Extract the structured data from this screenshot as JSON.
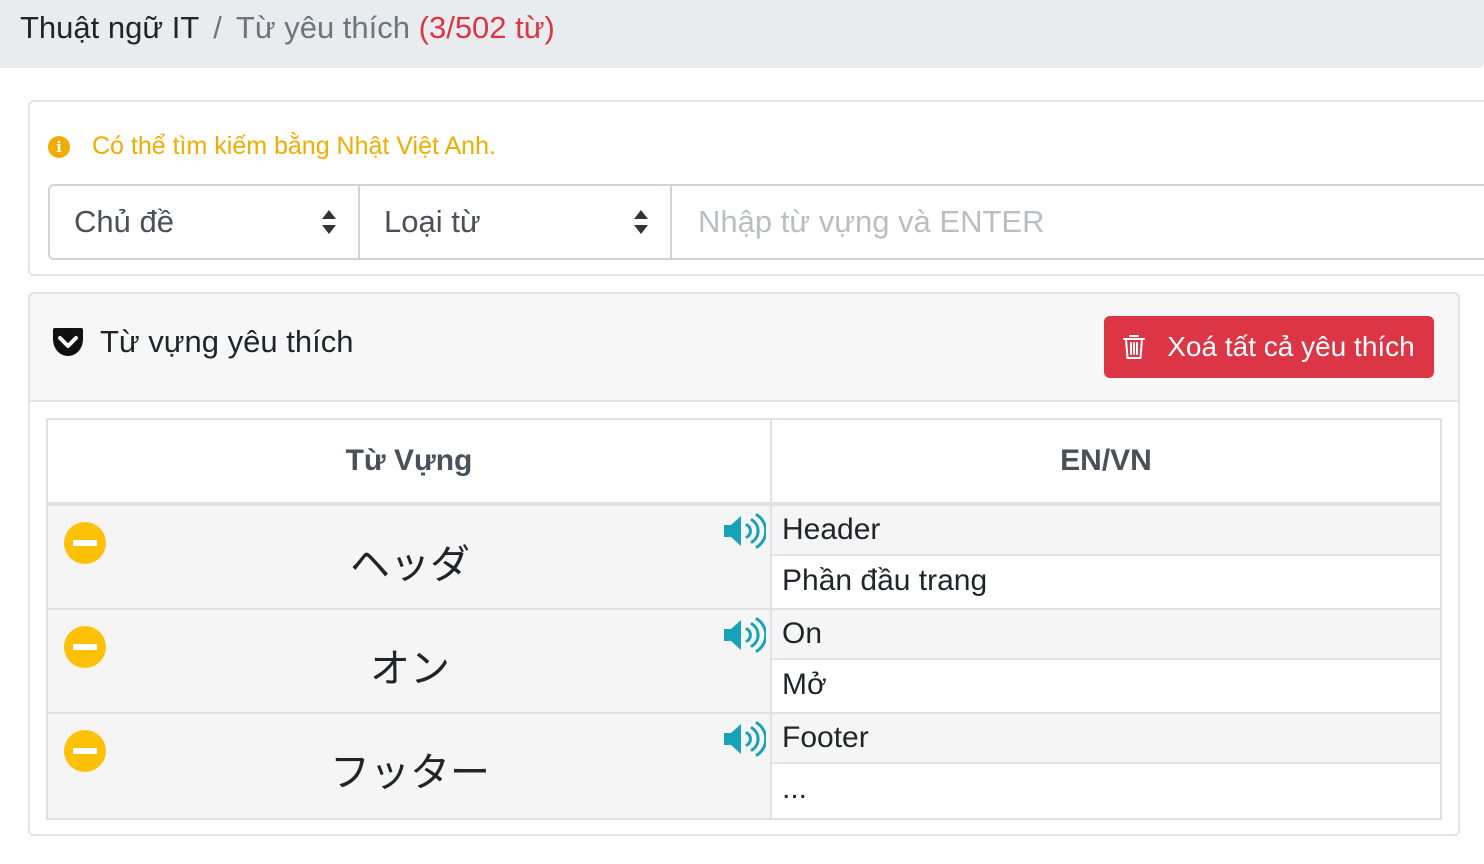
{
  "breadcrumb": {
    "root": "Thuật ngữ IT",
    "separator": "/",
    "current": "Từ yêu thích",
    "count": "(3/502 từ)"
  },
  "search": {
    "hint": "Có thể tìm kiếm bằng Nhật Việt Anh.",
    "topic_select": "Chủ đề",
    "wordtype_select": "Loại từ",
    "placeholder": "Nhập từ vựng và ENTER"
  },
  "favorites": {
    "title": "Từ vựng yêu thích",
    "clear_button": "Xoá tất cả yêu thích",
    "columns": {
      "word": "Từ Vựng",
      "meaning": "EN/VN"
    },
    "rows": [
      {
        "word": "ヘッダ",
        "en": "Header",
        "vn": "Phần đầu trang"
      },
      {
        "word": "オン",
        "en": "On",
        "vn": "Mở"
      },
      {
        "word": "フッター",
        "en": "Footer",
        "vn": "..."
      }
    ]
  },
  "colors": {
    "danger": "#dc3545",
    "warning": "#ffc107",
    "hint": "#f0ad00",
    "speaker": "#17a2b8"
  },
  "icons": {
    "info": "info-icon",
    "pocket": "pocket-icon",
    "trash": "trash-icon",
    "remove": "minus-circle-icon",
    "speaker": "speaker-icon"
  }
}
